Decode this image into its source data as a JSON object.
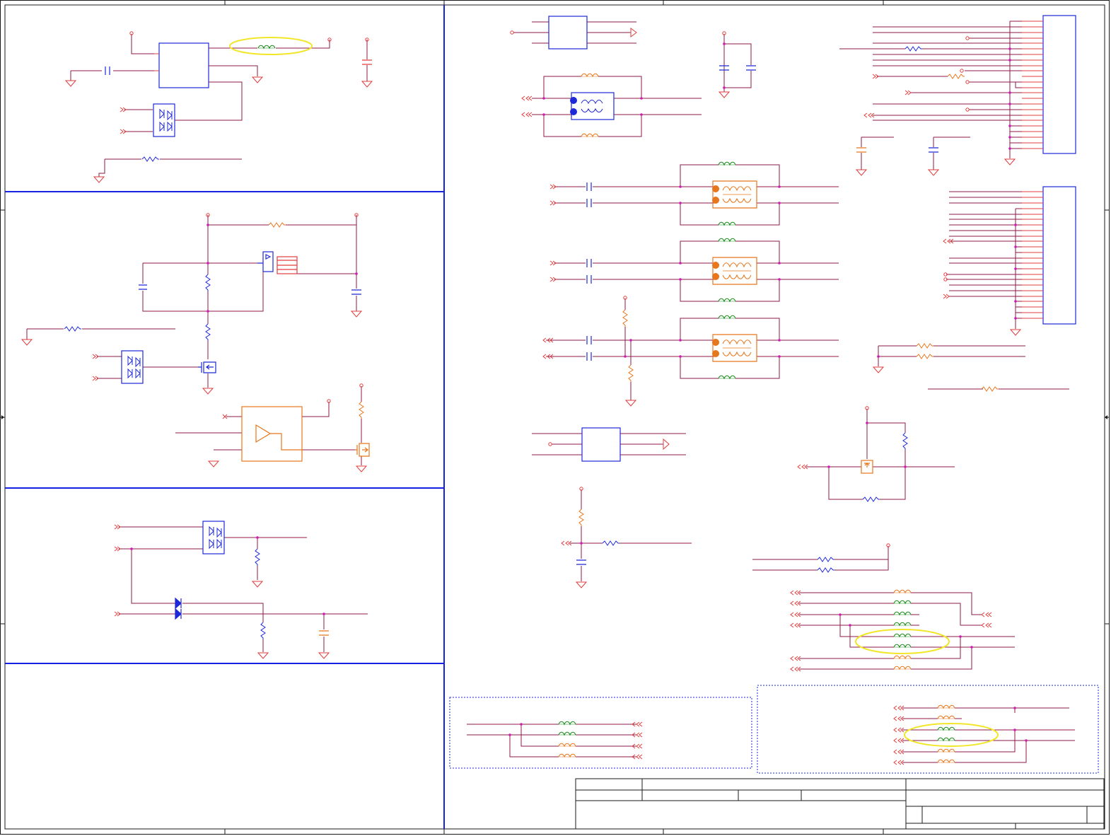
{
  "diagram": {
    "type": "electronic-schematic",
    "sheet_text": [],
    "title_block": {
      "title": "",
      "document_number": "",
      "revision": "",
      "size": "",
      "date": "",
      "sheet": ""
    },
    "colors": {
      "sheet_border": "#1a1a1a",
      "wire": "#8b1a4a",
      "pin": "#e23c3c",
      "component_blue": "#1e28d8",
      "component_orange": "#e8761a",
      "component_green": "#1f8a1f",
      "junction": "#d01ab0",
      "highlight": "#f2e62a",
      "section_divider": "#1522e0"
    },
    "sections": [
      {
        "id": "upper-left-block",
        "components": [
          "regulator-ic",
          "bead-inductor",
          "capacitor",
          "esd-diode-pair",
          "resistor"
        ]
      },
      {
        "id": "middle-left-block",
        "components": [
          "p-mosfet",
          "resistor",
          "capacitor",
          "esd-diode-pair",
          "n-mosfet",
          "comparator-ic"
        ]
      },
      {
        "id": "lower-left-block",
        "components": [
          "esd-diode-pair",
          "schottky-diode",
          "resistor",
          "capacitor"
        ]
      },
      {
        "id": "right-main-block",
        "components": [
          "usb-common-mode-choke",
          "common-mode-choke-x3",
          "connector-a",
          "connector-b",
          "mosfet",
          "resistor-array",
          "bead-array"
        ]
      }
    ],
    "highlights": [
      {
        "note": "bead-on-supply-line"
      },
      {
        "note": "bead-pair-in-array"
      },
      {
        "note": "bead-pair-in-dotted-box"
      }
    ]
  }
}
